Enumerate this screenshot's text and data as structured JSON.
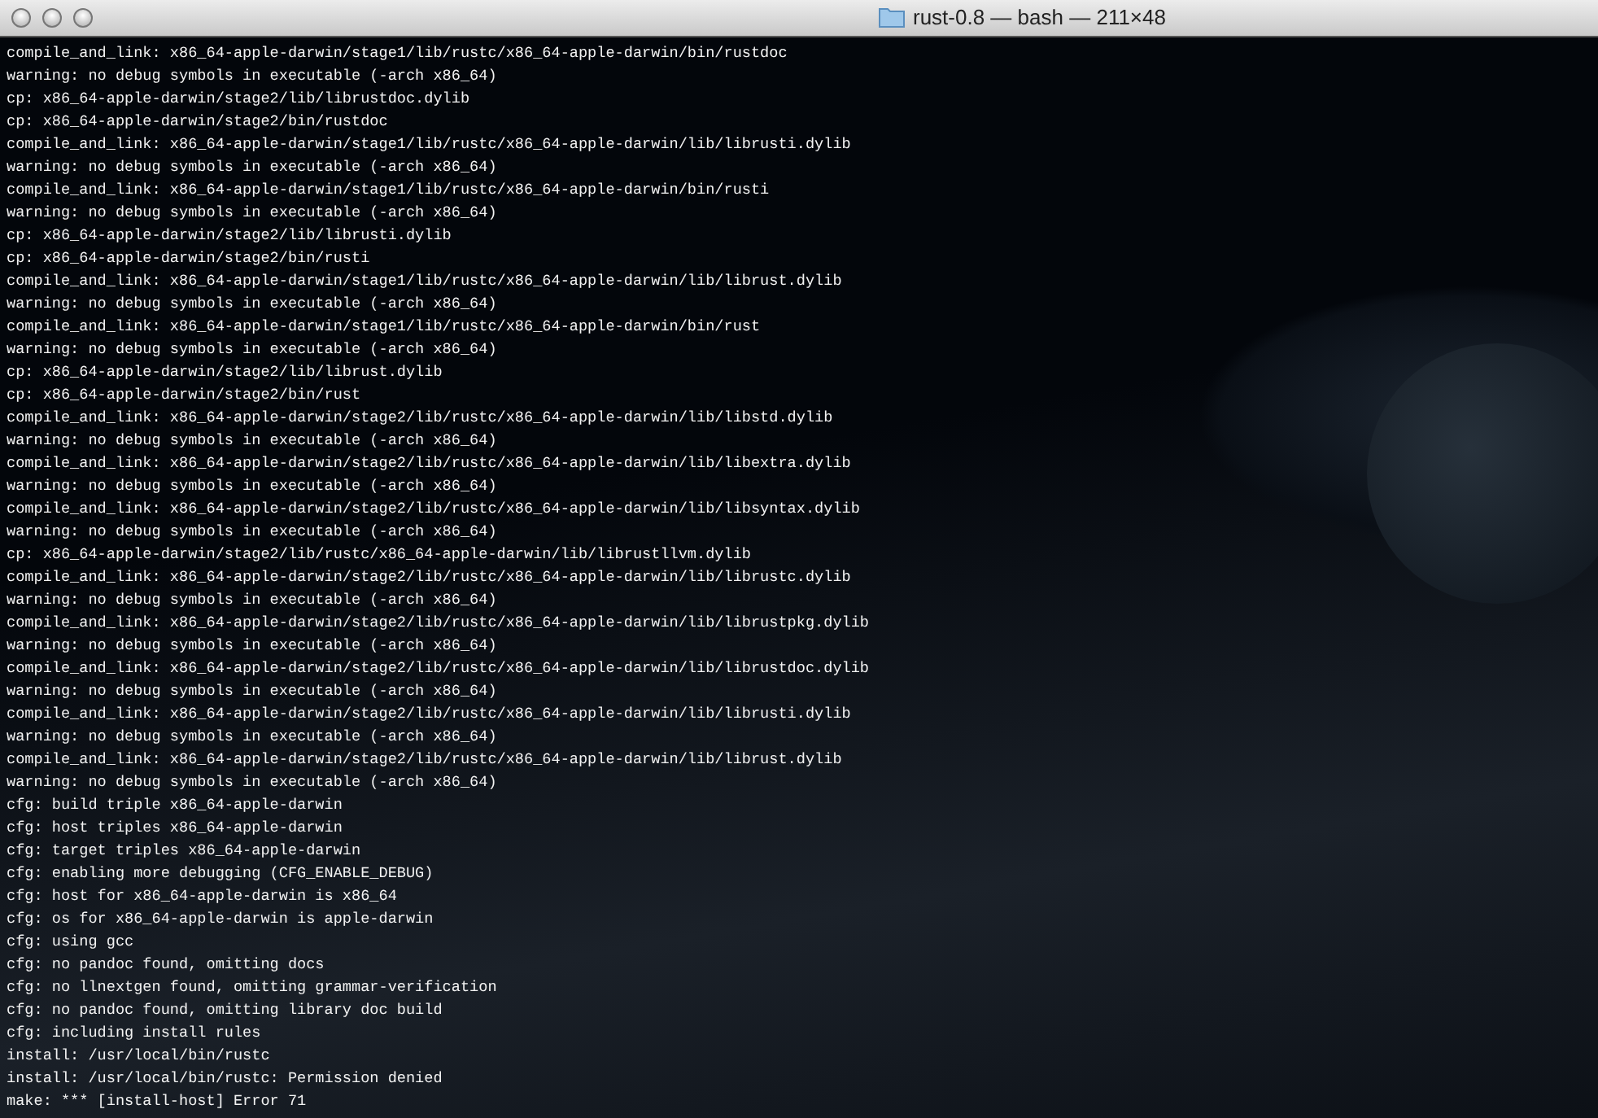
{
  "window": {
    "title": "rust-0.8 — bash — 211×48"
  },
  "terminal": {
    "lines": [
      "compile_and_link: x86_64-apple-darwin/stage1/lib/rustc/x86_64-apple-darwin/bin/rustdoc",
      "warning: no debug symbols in executable (-arch x86_64)",
      "cp: x86_64-apple-darwin/stage2/lib/librustdoc.dylib",
      "cp: x86_64-apple-darwin/stage2/bin/rustdoc",
      "compile_and_link: x86_64-apple-darwin/stage1/lib/rustc/x86_64-apple-darwin/lib/librusti.dylib",
      "warning: no debug symbols in executable (-arch x86_64)",
      "compile_and_link: x86_64-apple-darwin/stage1/lib/rustc/x86_64-apple-darwin/bin/rusti",
      "warning: no debug symbols in executable (-arch x86_64)",
      "cp: x86_64-apple-darwin/stage2/lib/librusti.dylib",
      "cp: x86_64-apple-darwin/stage2/bin/rusti",
      "compile_and_link: x86_64-apple-darwin/stage1/lib/rustc/x86_64-apple-darwin/lib/librust.dylib",
      "warning: no debug symbols in executable (-arch x86_64)",
      "compile_and_link: x86_64-apple-darwin/stage1/lib/rustc/x86_64-apple-darwin/bin/rust",
      "warning: no debug symbols in executable (-arch x86_64)",
      "cp: x86_64-apple-darwin/stage2/lib/librust.dylib",
      "cp: x86_64-apple-darwin/stage2/bin/rust",
      "compile_and_link: x86_64-apple-darwin/stage2/lib/rustc/x86_64-apple-darwin/lib/libstd.dylib",
      "warning: no debug symbols in executable (-arch x86_64)",
      "compile_and_link: x86_64-apple-darwin/stage2/lib/rustc/x86_64-apple-darwin/lib/libextra.dylib",
      "warning: no debug symbols in executable (-arch x86_64)",
      "compile_and_link: x86_64-apple-darwin/stage2/lib/rustc/x86_64-apple-darwin/lib/libsyntax.dylib",
      "warning: no debug symbols in executable (-arch x86_64)",
      "cp: x86_64-apple-darwin/stage2/lib/rustc/x86_64-apple-darwin/lib/librustllvm.dylib",
      "compile_and_link: x86_64-apple-darwin/stage2/lib/rustc/x86_64-apple-darwin/lib/librustc.dylib",
      "warning: no debug symbols in executable (-arch x86_64)",
      "compile_and_link: x86_64-apple-darwin/stage2/lib/rustc/x86_64-apple-darwin/lib/librustpkg.dylib",
      "warning: no debug symbols in executable (-arch x86_64)",
      "compile_and_link: x86_64-apple-darwin/stage2/lib/rustc/x86_64-apple-darwin/lib/librustdoc.dylib",
      "warning: no debug symbols in executable (-arch x86_64)",
      "compile_and_link: x86_64-apple-darwin/stage2/lib/rustc/x86_64-apple-darwin/lib/librusti.dylib",
      "warning: no debug symbols in executable (-arch x86_64)",
      "compile_and_link: x86_64-apple-darwin/stage2/lib/rustc/x86_64-apple-darwin/lib/librust.dylib",
      "warning: no debug symbols in executable (-arch x86_64)",
      "cfg: build triple x86_64-apple-darwin",
      "cfg: host triples x86_64-apple-darwin",
      "cfg: target triples x86_64-apple-darwin",
      "cfg: enabling more debugging (CFG_ENABLE_DEBUG)",
      "cfg: host for x86_64-apple-darwin is x86_64",
      "cfg: os for x86_64-apple-darwin is apple-darwin",
      "cfg: using gcc",
      "cfg: no pandoc found, omitting docs",
      "cfg: no llnextgen found, omitting grammar-verification",
      "cfg: no pandoc found, omitting library doc build",
      "cfg: including install rules",
      "install: /usr/local/bin/rustc",
      "install: /usr/local/bin/rustc: Permission denied",
      "make: *** [install-host] Error 71"
    ]
  }
}
